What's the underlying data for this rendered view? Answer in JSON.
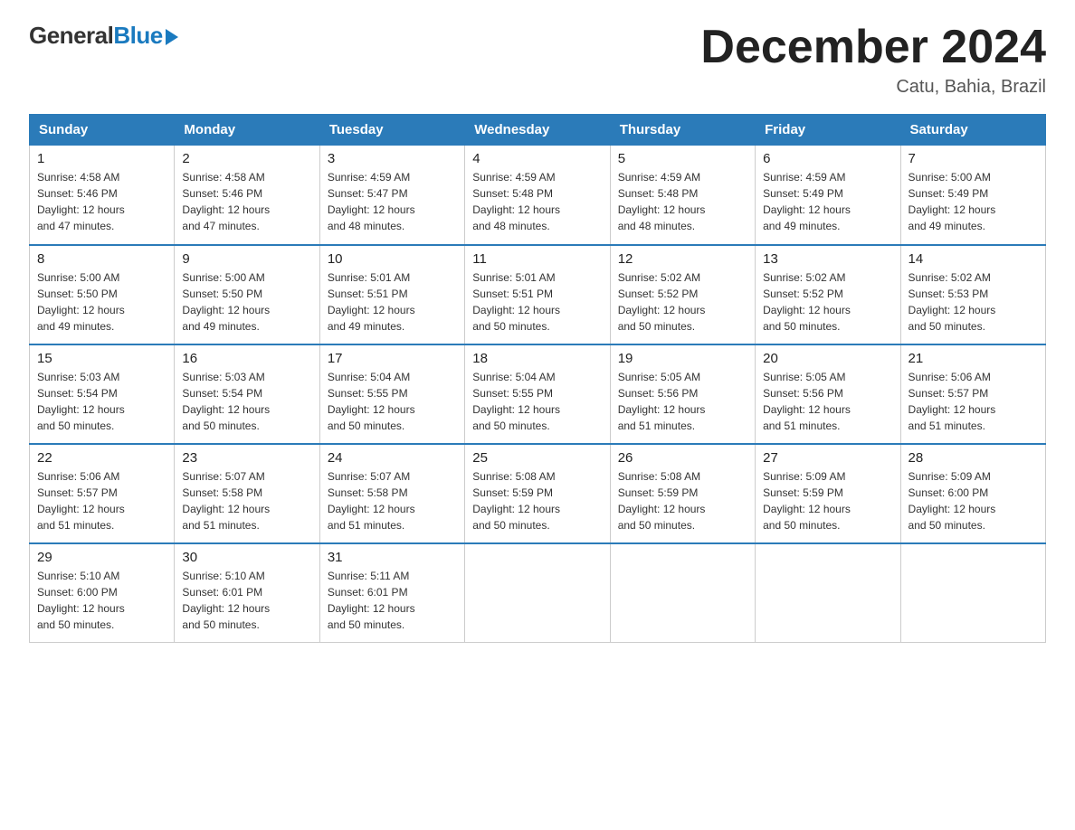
{
  "logo": {
    "general": "General",
    "blue": "Blue",
    "arrow": "▶"
  },
  "title": "December 2024",
  "subtitle": "Catu, Bahia, Brazil",
  "headers": [
    "Sunday",
    "Monday",
    "Tuesday",
    "Wednesday",
    "Thursday",
    "Friday",
    "Saturday"
  ],
  "weeks": [
    [
      {
        "day": "1",
        "sunrise": "4:58 AM",
        "sunset": "5:46 PM",
        "daylight": "12 hours and 47 minutes."
      },
      {
        "day": "2",
        "sunrise": "4:58 AM",
        "sunset": "5:46 PM",
        "daylight": "12 hours and 47 minutes."
      },
      {
        "day": "3",
        "sunrise": "4:59 AM",
        "sunset": "5:47 PM",
        "daylight": "12 hours and 48 minutes."
      },
      {
        "day": "4",
        "sunrise": "4:59 AM",
        "sunset": "5:48 PM",
        "daylight": "12 hours and 48 minutes."
      },
      {
        "day": "5",
        "sunrise": "4:59 AM",
        "sunset": "5:48 PM",
        "daylight": "12 hours and 48 minutes."
      },
      {
        "day": "6",
        "sunrise": "4:59 AM",
        "sunset": "5:49 PM",
        "daylight": "12 hours and 49 minutes."
      },
      {
        "day": "7",
        "sunrise": "5:00 AM",
        "sunset": "5:49 PM",
        "daylight": "12 hours and 49 minutes."
      }
    ],
    [
      {
        "day": "8",
        "sunrise": "5:00 AM",
        "sunset": "5:50 PM",
        "daylight": "12 hours and 49 minutes."
      },
      {
        "day": "9",
        "sunrise": "5:00 AM",
        "sunset": "5:50 PM",
        "daylight": "12 hours and 49 minutes."
      },
      {
        "day": "10",
        "sunrise": "5:01 AM",
        "sunset": "5:51 PM",
        "daylight": "12 hours and 49 minutes."
      },
      {
        "day": "11",
        "sunrise": "5:01 AM",
        "sunset": "5:51 PM",
        "daylight": "12 hours and 50 minutes."
      },
      {
        "day": "12",
        "sunrise": "5:02 AM",
        "sunset": "5:52 PM",
        "daylight": "12 hours and 50 minutes."
      },
      {
        "day": "13",
        "sunrise": "5:02 AM",
        "sunset": "5:52 PM",
        "daylight": "12 hours and 50 minutes."
      },
      {
        "day": "14",
        "sunrise": "5:02 AM",
        "sunset": "5:53 PM",
        "daylight": "12 hours and 50 minutes."
      }
    ],
    [
      {
        "day": "15",
        "sunrise": "5:03 AM",
        "sunset": "5:54 PM",
        "daylight": "12 hours and 50 minutes."
      },
      {
        "day": "16",
        "sunrise": "5:03 AM",
        "sunset": "5:54 PM",
        "daylight": "12 hours and 50 minutes."
      },
      {
        "day": "17",
        "sunrise": "5:04 AM",
        "sunset": "5:55 PM",
        "daylight": "12 hours and 50 minutes."
      },
      {
        "day": "18",
        "sunrise": "5:04 AM",
        "sunset": "5:55 PM",
        "daylight": "12 hours and 50 minutes."
      },
      {
        "day": "19",
        "sunrise": "5:05 AM",
        "sunset": "5:56 PM",
        "daylight": "12 hours and 51 minutes."
      },
      {
        "day": "20",
        "sunrise": "5:05 AM",
        "sunset": "5:56 PM",
        "daylight": "12 hours and 51 minutes."
      },
      {
        "day": "21",
        "sunrise": "5:06 AM",
        "sunset": "5:57 PM",
        "daylight": "12 hours and 51 minutes."
      }
    ],
    [
      {
        "day": "22",
        "sunrise": "5:06 AM",
        "sunset": "5:57 PM",
        "daylight": "12 hours and 51 minutes."
      },
      {
        "day": "23",
        "sunrise": "5:07 AM",
        "sunset": "5:58 PM",
        "daylight": "12 hours and 51 minutes."
      },
      {
        "day": "24",
        "sunrise": "5:07 AM",
        "sunset": "5:58 PM",
        "daylight": "12 hours and 51 minutes."
      },
      {
        "day": "25",
        "sunrise": "5:08 AM",
        "sunset": "5:59 PM",
        "daylight": "12 hours and 50 minutes."
      },
      {
        "day": "26",
        "sunrise": "5:08 AM",
        "sunset": "5:59 PM",
        "daylight": "12 hours and 50 minutes."
      },
      {
        "day": "27",
        "sunrise": "5:09 AM",
        "sunset": "5:59 PM",
        "daylight": "12 hours and 50 minutes."
      },
      {
        "day": "28",
        "sunrise": "5:09 AM",
        "sunset": "6:00 PM",
        "daylight": "12 hours and 50 minutes."
      }
    ],
    [
      {
        "day": "29",
        "sunrise": "5:10 AM",
        "sunset": "6:00 PM",
        "daylight": "12 hours and 50 minutes."
      },
      {
        "day": "30",
        "sunrise": "5:10 AM",
        "sunset": "6:01 PM",
        "daylight": "12 hours and 50 minutes."
      },
      {
        "day": "31",
        "sunrise": "5:11 AM",
        "sunset": "6:01 PM",
        "daylight": "12 hours and 50 minutes."
      },
      null,
      null,
      null,
      null
    ]
  ],
  "labels": {
    "sunrise": "Sunrise:",
    "sunset": "Sunset:",
    "daylight": "Daylight:"
  }
}
